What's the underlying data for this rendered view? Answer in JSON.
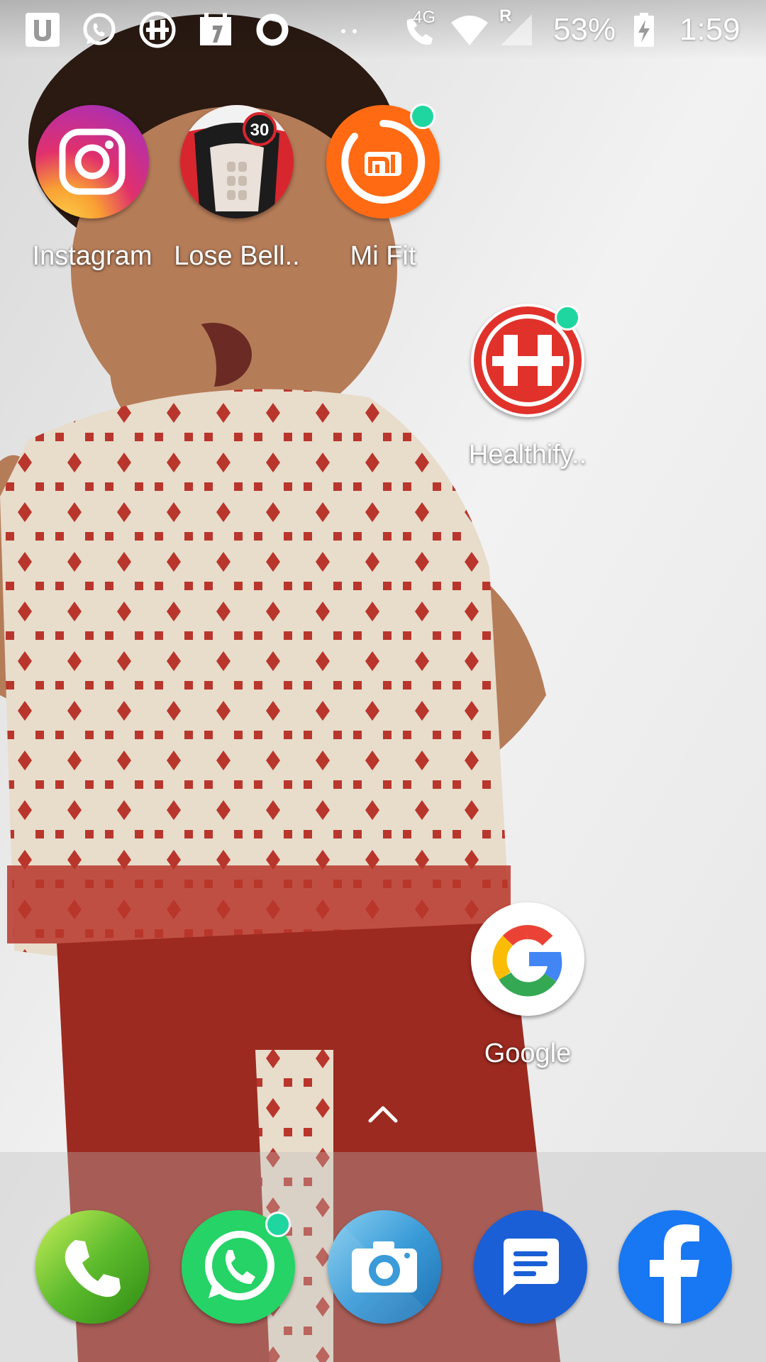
{
  "status_bar": {
    "icons": [
      "u-app-icon",
      "whatsapp-icon",
      "healthifyme-icon",
      "calendar-icon",
      "circle-icon",
      "more-dots-icon",
      "volte-call-icon",
      "wifi-icon",
      "signal-roaming-icon",
      "battery-charging-icon"
    ],
    "network_label": "4G",
    "roaming_label": "R",
    "battery": "53%",
    "time": "1:59"
  },
  "home_apps": [
    {
      "name": "instagram",
      "label": "Instagram",
      "badge": false
    },
    {
      "name": "lose-belly-fat",
      "label": "Lose Bell..",
      "badge": false,
      "icon_text": "30"
    },
    {
      "name": "mi-fit",
      "label": "Mi Fit",
      "badge": true
    },
    {
      "name": "healthifyme",
      "label": "Healthify..",
      "badge": true
    },
    {
      "name": "google",
      "label": "Google",
      "badge": false
    }
  ],
  "dock": [
    {
      "name": "phone",
      "icon": "phone-icon"
    },
    {
      "name": "whatsapp",
      "icon": "whatsapp-icon",
      "badge": true
    },
    {
      "name": "camera",
      "icon": "camera-icon"
    },
    {
      "name": "messages",
      "icon": "messages-icon"
    },
    {
      "name": "facebook",
      "icon": "facebook-icon"
    }
  ],
  "colors": {
    "badge": "#20d6a0",
    "instagram_gradient": [
      "#f9a033",
      "#e1306c",
      "#833ab4"
    ],
    "mi_fit": "#ff6a13",
    "healthifyme": "#e0322b",
    "whatsapp": "#25d366",
    "facebook": "#1877f2",
    "messages": "#1a5fd6"
  }
}
